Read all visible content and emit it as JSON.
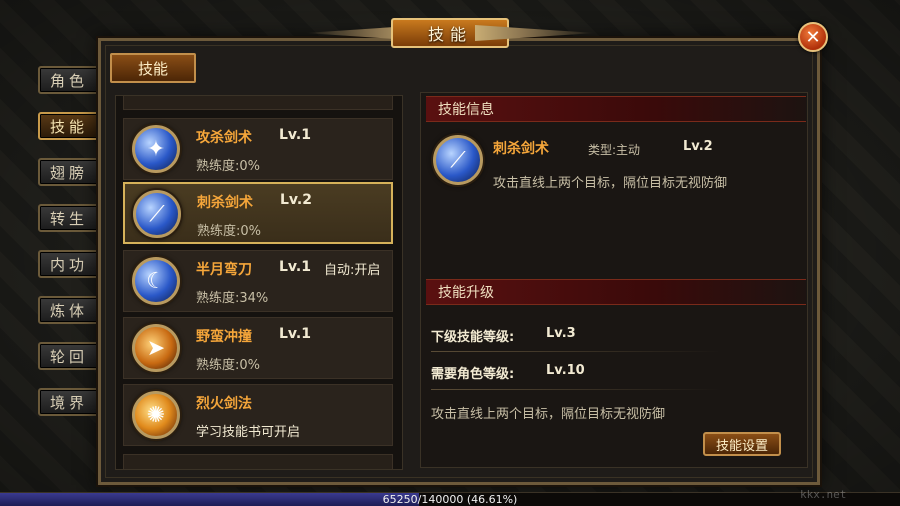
{
  "window": {
    "title": "技能",
    "close": "✕"
  },
  "side_tabs": [
    {
      "label": "角色",
      "active": false
    },
    {
      "label": "技能",
      "active": true
    },
    {
      "label": "翅膀",
      "active": false
    },
    {
      "label": "转生",
      "active": false
    },
    {
      "label": "内功",
      "active": false
    },
    {
      "label": "炼体",
      "active": false
    },
    {
      "label": "轮回",
      "active": false
    },
    {
      "label": "境界",
      "active": false
    }
  ],
  "sub_tab": "技能",
  "skills": [
    {
      "name": "攻杀剑术",
      "level": "Lv.1",
      "auto": "",
      "sub": "熟练度:0%",
      "icon": "sword-slash-icon",
      "color": "blue"
    },
    {
      "name": "刺杀剑术",
      "level": "Lv.2",
      "auto": "",
      "sub": "熟练度:0%",
      "icon": "sword-thrust-icon",
      "color": "blue",
      "selected": true
    },
    {
      "name": "半月弯刀",
      "level": "Lv.1",
      "auto": "自动:开启",
      "sub": "熟练度:34%",
      "icon": "half-moon-icon",
      "color": "blue"
    },
    {
      "name": "野蛮冲撞",
      "level": "Lv.1",
      "auto": "",
      "sub": "熟练度:0%",
      "icon": "charge-icon",
      "color": "orange"
    },
    {
      "name": "烈火剑法",
      "level": "",
      "auto": "",
      "sub": "学习技能书可开启",
      "icon": "fire-sword-icon",
      "color": "fire"
    }
  ],
  "info": {
    "section_title": "技能信息",
    "name": "刺杀剑术",
    "type": "类型:主动",
    "level": "Lv.2",
    "description": "攻击直线上两个目标，隔位目标无视防御"
  },
  "upgrade": {
    "section_title": "技能升级",
    "next_label": "下级技能等级:",
    "next_value": "Lv.3",
    "req_label": "需要角色等级:",
    "req_value": "Lv.10",
    "description": "攻击直线上两个目标，隔位目标无视防御",
    "settings_button": "技能设置"
  },
  "exp": {
    "text": "65250/140000 (46.61%)",
    "fraction": 0.4661
  },
  "watermark": "kkx.net",
  "colors": {
    "accent": "#f5a63a",
    "section_red": "#5a1010",
    "selected_border": "#d6b25a"
  }
}
